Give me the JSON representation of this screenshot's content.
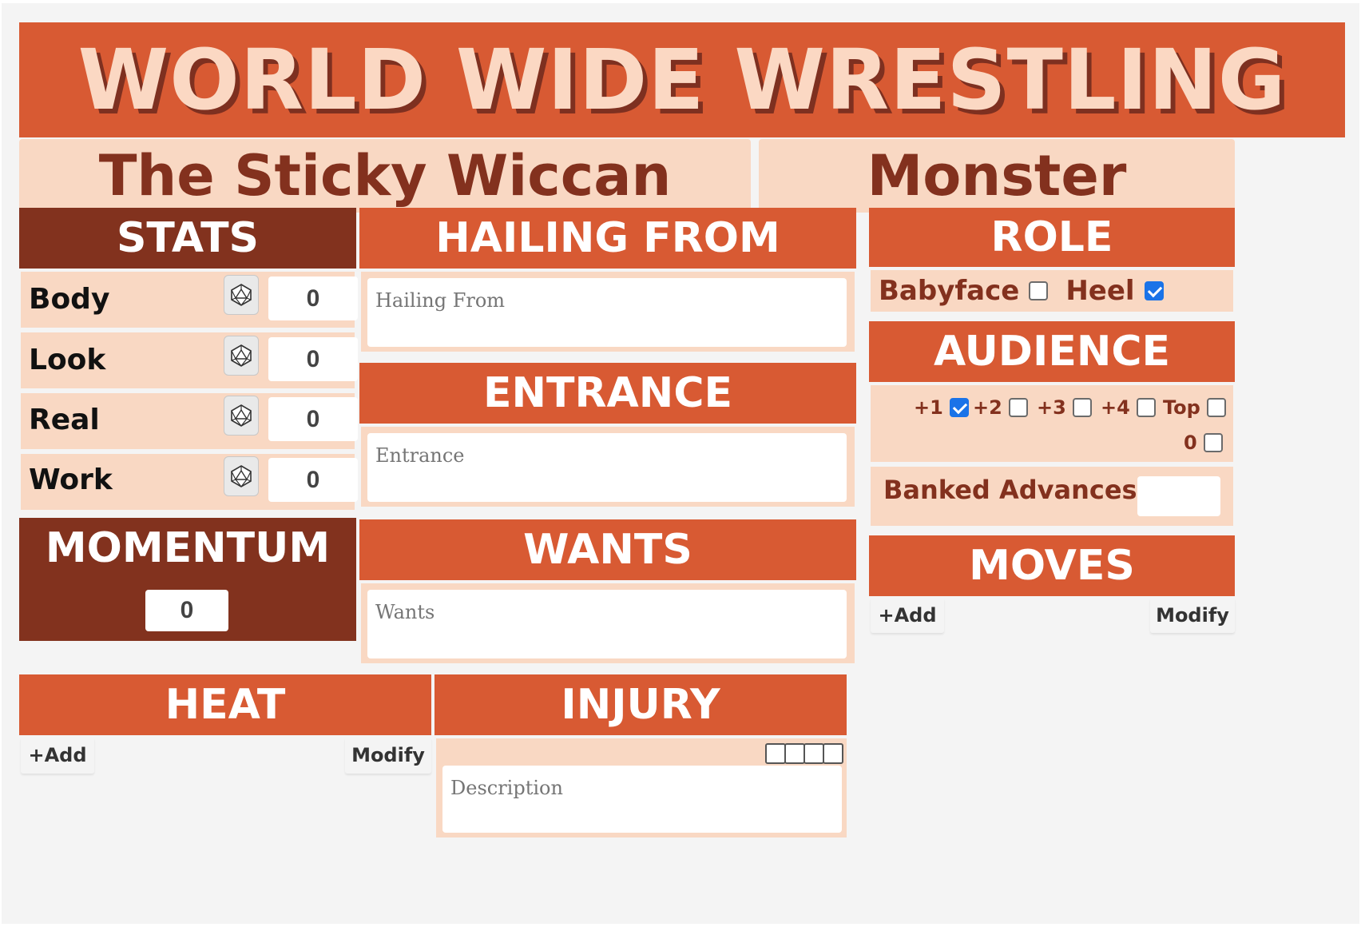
{
  "banner": {
    "title": "WORLD WIDE WRESTLING"
  },
  "character": {
    "name": "The Sticky Wiccan",
    "gimmick": "Monster"
  },
  "stats": {
    "header": "STATS",
    "rows": [
      {
        "label": "Body",
        "value": "0"
      },
      {
        "label": "Look",
        "value": "0"
      },
      {
        "label": "Real",
        "value": "0"
      },
      {
        "label": "Work",
        "value": "0"
      }
    ]
  },
  "momentum": {
    "header": "MOMENTUM",
    "value": "0"
  },
  "hailing_from": {
    "header": "HAILING FROM",
    "placeholder": "Hailing From"
  },
  "entrance": {
    "header": "ENTRANCE",
    "placeholder": "Entrance"
  },
  "wants": {
    "header": "WANTS",
    "placeholder": "Wants"
  },
  "role": {
    "header": "ROLE",
    "babyface_label": "Babyface",
    "babyface_checked": false,
    "heel_label": "Heel",
    "heel_checked": true
  },
  "audience": {
    "header": "AUDIENCE",
    "options": [
      {
        "label": "+1",
        "checked": true
      },
      {
        "label": "+2",
        "checked": false
      },
      {
        "label": "+3",
        "checked": false
      },
      {
        "label": "+4",
        "checked": false
      },
      {
        "label": "Top",
        "checked": false
      },
      {
        "label": "0",
        "checked": false
      }
    ],
    "banked_label": "Banked Advances",
    "banked_value": ""
  },
  "moves": {
    "header": "MOVES",
    "add_label": "+Add",
    "modify_label": "Modify"
  },
  "heat": {
    "header": "HEAT",
    "add_label": "+Add",
    "modify_label": "Modify"
  },
  "injury": {
    "header": "INJURY",
    "placeholder": "Description",
    "boxes_checked": [
      false,
      false,
      false,
      false
    ]
  },
  "colors": {
    "orange": "#d85a33",
    "dark_brown": "#82321e",
    "peach": "#f9d8c3",
    "text_brown": "#83311e",
    "checkbox_blue": "#1a73e8"
  },
  "icons": {
    "dice": "d20-dice-icon"
  }
}
